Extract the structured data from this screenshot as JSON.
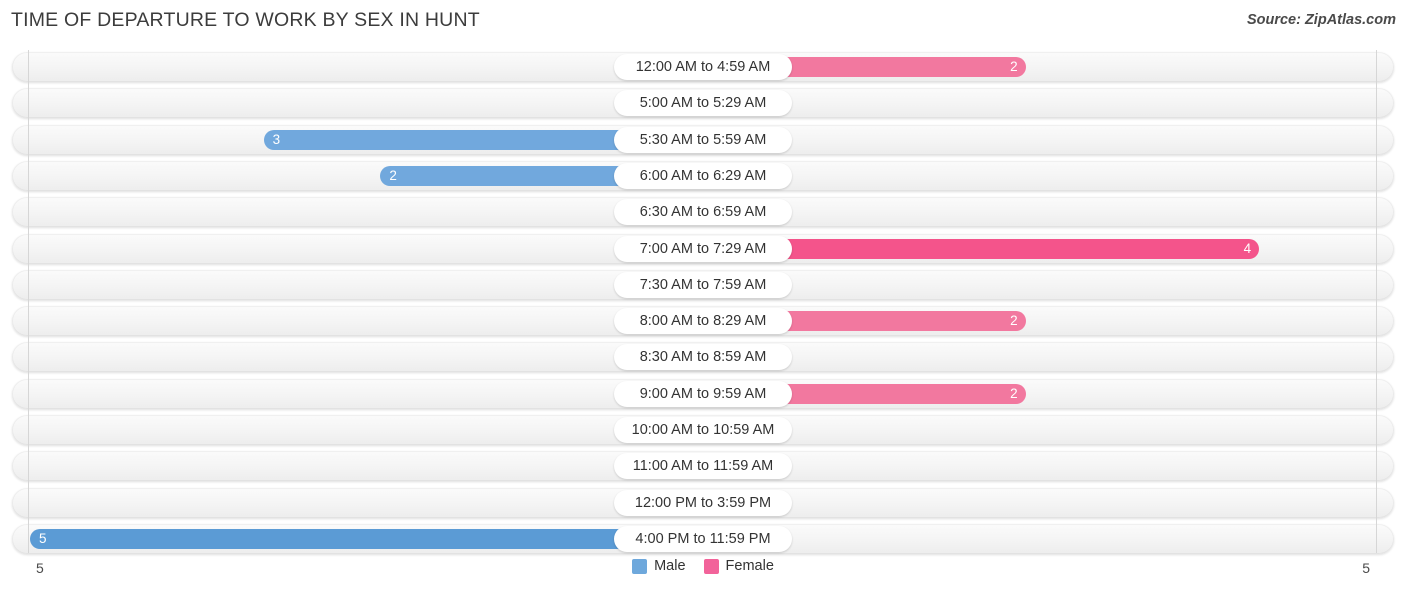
{
  "header": {
    "title": "TIME OF DEPARTURE TO WORK BY SEX IN HUNT",
    "source": "Source: ZipAtlas.com"
  },
  "axis": {
    "left_tick": "5",
    "right_tick": "5",
    "max": 5
  },
  "legend": {
    "items": [
      {
        "label": "Male",
        "color": "#6ea8dc"
      },
      {
        "label": "Female",
        "color": "#f2639a"
      }
    ]
  },
  "colors": {
    "male_zero": "#a8c8ea",
    "male_low": "#8fbae5",
    "male_mid": "#71a8dd",
    "male_high": "#5b9bd5",
    "female_zero": "#f7b0cb",
    "female_low": "#f59bbd",
    "female_mid": "#f2789f",
    "female_high": "#f4548b",
    "row_bg": "#f4f4f4",
    "gridline": "#d6d6d6"
  },
  "chart_data": {
    "type": "bar",
    "orientation": "horizontal",
    "layout": "diverging-pyramid",
    "title": "TIME OF DEPARTURE TO WORK BY SEX IN HUNT",
    "xlabel": "",
    "ylabel": "",
    "xlim": [
      5,
      0,
      5
    ],
    "grid": true,
    "legend_position": "bottom-center",
    "categories": [
      "12:00 AM to 4:59 AM",
      "5:00 AM to 5:29 AM",
      "5:30 AM to 5:59 AM",
      "6:00 AM to 6:29 AM",
      "6:30 AM to 6:59 AM",
      "7:00 AM to 7:29 AM",
      "7:30 AM to 7:59 AM",
      "8:00 AM to 8:29 AM",
      "8:30 AM to 8:59 AM",
      "9:00 AM to 9:59 AM",
      "10:00 AM to 10:59 AM",
      "11:00 AM to 11:59 AM",
      "12:00 PM to 3:59 PM",
      "4:00 PM to 11:59 PM"
    ],
    "series": [
      {
        "name": "Male",
        "values": [
          0,
          0,
          3,
          2,
          0,
          0,
          0,
          0,
          0,
          0,
          0,
          0,
          0,
          5
        ],
        "labels": [
          "0",
          "0",
          "3",
          "2",
          "0",
          "0",
          "0",
          "0",
          "0",
          "0",
          "0",
          "0",
          "0",
          "5"
        ]
      },
      {
        "name": "Female",
        "values": [
          2,
          0,
          0,
          0,
          0,
          4,
          0,
          2,
          0,
          2,
          0,
          0,
          0,
          0
        ],
        "labels": [
          "2",
          "0",
          "0",
          "0",
          "0",
          "4",
          "0",
          "2",
          "0",
          "2",
          "0",
          "0",
          "0",
          "0"
        ]
      }
    ]
  }
}
